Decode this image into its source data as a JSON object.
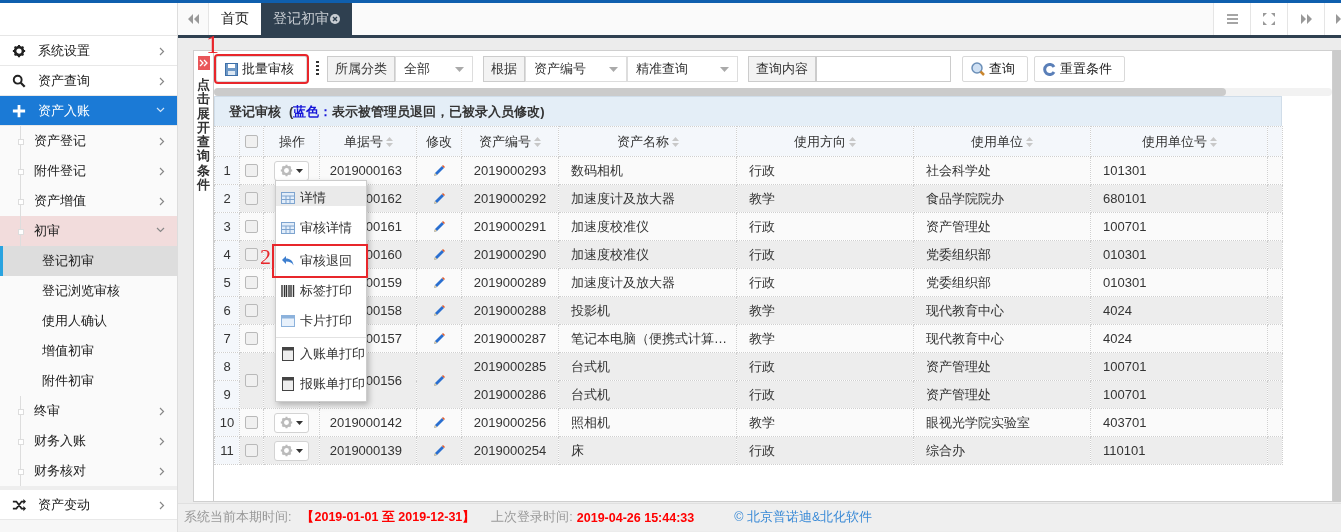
{
  "tabs": {
    "items": [
      {
        "label": "首页",
        "selected": false,
        "closable": false
      },
      {
        "label": "登记初审",
        "selected": true,
        "closable": true
      }
    ]
  },
  "sidebar": {
    "items": [
      {
        "label": "系统设置",
        "selected": false,
        "expanded": false
      },
      {
        "label": "资产查询",
        "selected": false,
        "expanded": false
      },
      {
        "label": "资产入账",
        "selected": true,
        "expanded": true,
        "children": [
          {
            "label": "资产登记",
            "selected": false,
            "expanded": false
          },
          {
            "label": "附件登记",
            "selected": false,
            "expanded": false
          },
          {
            "label": "资产增值",
            "selected": false,
            "expanded": false
          },
          {
            "label": "初审",
            "selected": false,
            "expanded": true,
            "children": [
              {
                "label": "登记初审",
                "selected": true
              },
              {
                "label": "登记浏览审核",
                "selected": false
              },
              {
                "label": "使用人确认",
                "selected": false
              },
              {
                "label": "增值初审",
                "selected": false
              },
              {
                "label": "附件初审",
                "selected": false
              }
            ]
          },
          {
            "label": "终审",
            "selected": false,
            "expanded": false
          },
          {
            "label": "财务入账",
            "selected": false,
            "expanded": false
          },
          {
            "label": "财务核对",
            "selected": false,
            "expanded": false
          }
        ]
      },
      {
        "label": "资产变动",
        "selected": false,
        "expanded": false
      }
    ]
  },
  "query_panel": {
    "toggle_label": "点击展开查询条件",
    "batch_button": {
      "label": "批量审核",
      "annotation": "1"
    },
    "filters": [
      {
        "kind": "select",
        "label": "所属分类",
        "selects": [
          "全部"
        ]
      },
      {
        "kind": "select",
        "label": "根据",
        "selects": [
          "资产编号",
          "精准查询"
        ]
      },
      {
        "kind": "text",
        "label": "查询内容"
      }
    ],
    "buttons": [
      {
        "label": "查询"
      },
      {
        "label": "重置条件"
      }
    ]
  },
  "grid": {
    "title": "登记审核",
    "note": [
      {
        "text": "(",
        "highlight": false
      },
      {
        "text": "蓝色：",
        "highlight": true
      },
      {
        "text": "表示被管理员退回，已被录入员修改)",
        "highlight": false
      }
    ],
    "header_checked": false,
    "columns": [
      {
        "label": "操作",
        "sortable": false
      },
      {
        "label": "单据号",
        "sortable": true
      },
      {
        "label": "修改",
        "sortable": false
      },
      {
        "label": "资产编号",
        "sortable": true
      },
      {
        "label": "资产名称",
        "sortable": true
      },
      {
        "label": "使用方向",
        "sortable": true
      },
      {
        "label": "使用单位",
        "sortable": true
      },
      {
        "label": "使用单位号",
        "sortable": true
      }
    ],
    "rows": [
      {
        "row_numbers": [
          "1"
        ],
        "checked": false,
        "action_button": true,
        "doc_no": "2019000163",
        "assets": [
          {
            "asset_no": "2019000293",
            "name": "数码相机",
            "direction": "行政",
            "unit": "社会科学处",
            "unit_no": "101301"
          }
        ]
      },
      {
        "row_numbers": [
          "2"
        ],
        "checked": false,
        "action_button": false,
        "doc_no": "00162",
        "assets": [
          {
            "asset_no": "2019000292",
            "name": "加速度计及放大器",
            "direction": "教学",
            "unit": "食品学院院办",
            "unit_no": "680101"
          }
        ]
      },
      {
        "row_numbers": [
          "3"
        ],
        "checked": false,
        "action_button": false,
        "doc_no": "00161",
        "assets": [
          {
            "asset_no": "2019000291",
            "name": "加速度校准仪",
            "direction": "行政",
            "unit": "资产管理处",
            "unit_no": "100701"
          }
        ]
      },
      {
        "row_numbers": [
          "4"
        ],
        "checked": false,
        "action_button": false,
        "doc_no": "00160",
        "assets": [
          {
            "asset_no": "2019000290",
            "name": "加速度校准仪",
            "direction": "行政",
            "unit": "党委组织部",
            "unit_no": "010301"
          }
        ]
      },
      {
        "row_numbers": [
          "5"
        ],
        "checked": false,
        "action_button": false,
        "doc_no": "00159",
        "assets": [
          {
            "asset_no": "2019000289",
            "name": "加速度计及放大器",
            "direction": "行政",
            "unit": "党委组织部",
            "unit_no": "010301"
          }
        ]
      },
      {
        "row_numbers": [
          "6"
        ],
        "checked": false,
        "action_button": false,
        "doc_no": "00158",
        "assets": [
          {
            "asset_no": "2019000288",
            "name": "投影机",
            "direction": "教学",
            "unit": "现代教育中心",
            "unit_no": "4024"
          }
        ]
      },
      {
        "row_numbers": [
          "7"
        ],
        "checked": false,
        "action_button": false,
        "doc_no": "00157",
        "assets": [
          {
            "asset_no": "2019000287",
            "name": "笔记本电脑（便携式计算…",
            "direction": "教学",
            "unit": "现代教育中心",
            "unit_no": "4024"
          }
        ]
      },
      {
        "row_numbers": [
          "8",
          "9"
        ],
        "checked": false,
        "action_button": false,
        "doc_no": "00156",
        "assets": [
          {
            "asset_no": "2019000285",
            "name": "台式机",
            "direction": "行政",
            "unit": "资产管理处",
            "unit_no": "100701"
          },
          {
            "asset_no": "2019000286",
            "name": "台式机",
            "direction": "行政",
            "unit": "资产管理处",
            "unit_no": "100701"
          }
        ]
      },
      {
        "row_numbers": [
          "10"
        ],
        "checked": false,
        "action_button": true,
        "doc_no": "2019000142",
        "assets": [
          {
            "asset_no": "2019000256",
            "name": "照相机",
            "direction": "教学",
            "unit": "眼视光学院实验室",
            "unit_no": "403701"
          }
        ]
      },
      {
        "row_numbers": [
          "11"
        ],
        "checked": false,
        "action_button": true,
        "doc_no": "2019000139",
        "assets": [
          {
            "asset_no": "2019000254",
            "name": "床",
            "direction": "行政",
            "unit": "综合办",
            "unit_no": "110101"
          }
        ]
      }
    ],
    "menu": {
      "annotation": "2",
      "items": [
        {
          "kind": "item",
          "label": "详情",
          "hovered": true,
          "annotated": false
        },
        {
          "kind": "item",
          "label": "审核详情",
          "hovered": false,
          "annotated": false
        },
        {
          "kind": "separator"
        },
        {
          "kind": "item",
          "label": "审核退回",
          "hovered": false,
          "annotated": true
        },
        {
          "kind": "item",
          "label": "标签打印",
          "hovered": false,
          "annotated": false
        },
        {
          "kind": "item",
          "label": "卡片打印",
          "hovered": false,
          "annotated": false
        },
        {
          "kind": "separator"
        },
        {
          "kind": "item",
          "label": "入账单打印",
          "hovered": false,
          "annotated": false
        },
        {
          "kind": "item",
          "label": "报账单打印",
          "hovered": false,
          "annotated": false
        }
      ]
    }
  },
  "status_bar": {
    "period_label": "系统当前本期时间:",
    "period": "【2019-01-01 至 2019-12-31】",
    "login_label": "上次登录时间:",
    "login_time": "2019-04-26 15:44:33",
    "copyright": "© 北京普诺迪&北化软件"
  }
}
